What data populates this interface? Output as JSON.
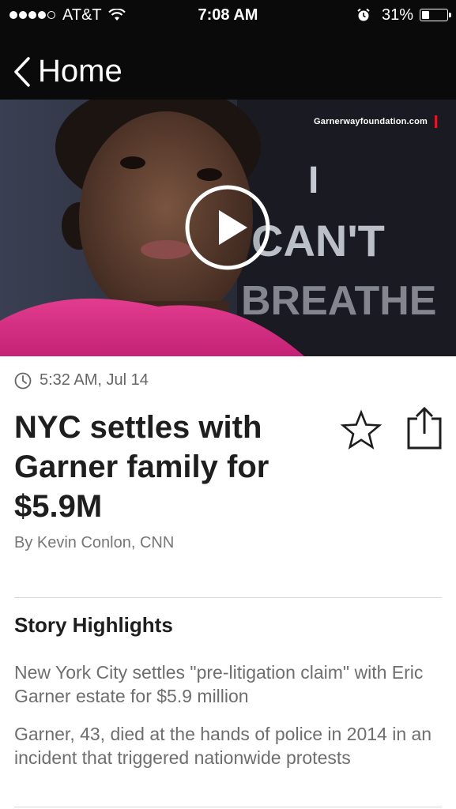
{
  "status_bar": {
    "carrier": "AT&T",
    "time": "7:08 AM",
    "battery": "31%",
    "battery_level": 0.31,
    "signal_bars": 4,
    "signal_max": 5
  },
  "nav": {
    "back_label": "Home"
  },
  "video": {
    "watermark": "Garnerwayfoundation.com",
    "shirt_text": "I CAN'T BREATHE",
    "accent_color": "#e3132a"
  },
  "article": {
    "timestamp": "5:32 AM, Jul 14",
    "headline": "NYC settles with Garner family for $5.9M",
    "byline": "By Kevin Conlon, CNN"
  },
  "highlights": {
    "title": "Story Highlights",
    "items": [
      "New York City settles \"pre-litigation claim\" with Eric Garner estate for $5.9 million",
      "Garner, 43, died at the hands of police in 2014 in an incident that triggered nationwide protests"
    ]
  },
  "icons": {
    "clock": "clock-icon",
    "star": "star-icon",
    "share": "share-icon",
    "play": "play-icon",
    "back": "chevron-left-icon"
  }
}
